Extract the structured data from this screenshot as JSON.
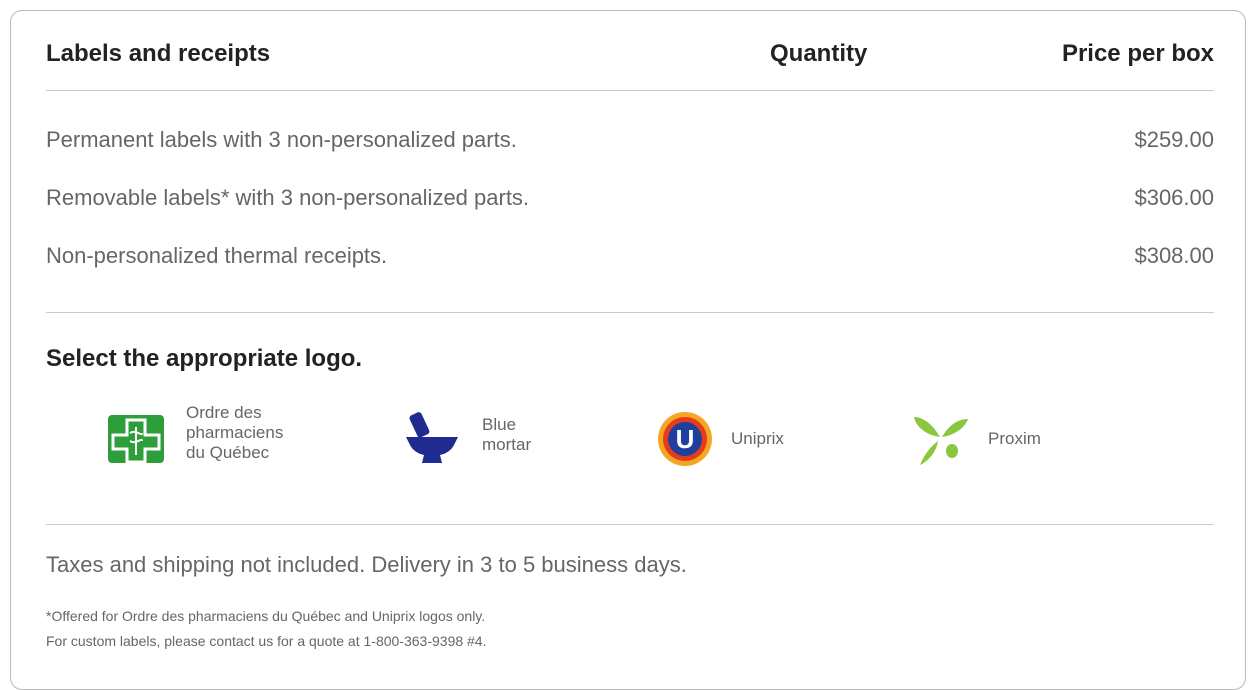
{
  "header": {
    "title": "Labels and receipts",
    "quantity_label": "Quantity",
    "price_label": "Price per box"
  },
  "items": [
    {
      "name": "Permanent labels with 3 non-personalized parts.",
      "price": "$259.00"
    },
    {
      "name": "Removable labels* with 3 non-personalized parts.",
      "price": "$306.00"
    },
    {
      "name": "Non-personalized thermal receipts.",
      "price": "$308.00"
    }
  ],
  "logo_section": {
    "title": "Select the appropriate logo.",
    "options": [
      {
        "label_lines": [
          "Ordre des",
          "pharmaciens",
          "du Québec"
        ],
        "icon": "pharmacy-cross-icon",
        "color": "#2e9e3a"
      },
      {
        "label_lines": [
          "Blue",
          "mortar"
        ],
        "icon": "mortar-pestle-icon",
        "color": "#1f2b8f"
      },
      {
        "label_lines": [
          "Uniprix"
        ],
        "icon": "uniprix-logo-icon",
        "color": "#1e3f9e"
      },
      {
        "label_lines": [
          "Proxim"
        ],
        "icon": "proxim-leaf-icon",
        "color": "#8cc63f"
      }
    ]
  },
  "footer": {
    "note": "Taxes and shipping not included. Delivery in 3 to 5 business days.",
    "footnote": "*Offered for Ordre des pharmaciens du Québec and Uniprix logos only.",
    "contact": "For custom labels, please contact us for a quote at 1-800-363-9398 #4."
  }
}
